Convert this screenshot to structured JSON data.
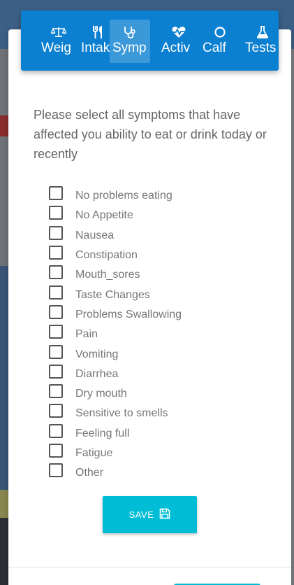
{
  "tabs": [
    {
      "label": "Weig",
      "icon": "balance-scale-icon",
      "active": false
    },
    {
      "label": "Intak",
      "icon": "utensils-icon",
      "active": false
    },
    {
      "label": "Symp",
      "icon": "stethoscope-icon",
      "active": true
    },
    {
      "label": "Activ",
      "icon": "heartbeat-icon",
      "active": false
    },
    {
      "label": "Calf",
      "icon": "circle-icon",
      "active": false
    },
    {
      "label": "Tests",
      "icon": "flask-icon",
      "active": false
    }
  ],
  "instructions": "Please select all symptoms that have affected you ability to eat or drink today or recently",
  "symptoms": [
    {
      "label": "No problems eating",
      "checked": false
    },
    {
      "label": "No Appetite",
      "checked": false
    },
    {
      "label": "Nausea",
      "checked": false
    },
    {
      "label": "Constipation",
      "checked": false
    },
    {
      "label": "Mouth_sores",
      "checked": false
    },
    {
      "label": "Taste Changes",
      "checked": false
    },
    {
      "label": "Problems Swallowing",
      "checked": false
    },
    {
      "label": "Pain",
      "checked": false
    },
    {
      "label": "Vomiting",
      "checked": false
    },
    {
      "label": "Diarrhea",
      "checked": false
    },
    {
      "label": "Dry mouth",
      "checked": false
    },
    {
      "label": "Sensitive to smells",
      "checked": false
    },
    {
      "label": "Feeling full",
      "checked": false
    },
    {
      "label": "Fatigue",
      "checked": false
    },
    {
      "label": "Other",
      "checked": false
    }
  ],
  "save_button": {
    "label": "SAVE",
    "icon": "floppy-disk-icon"
  },
  "colors": {
    "tabbar": "#0b7fd0",
    "save_button": "#00bcd4",
    "text": "#666666"
  }
}
